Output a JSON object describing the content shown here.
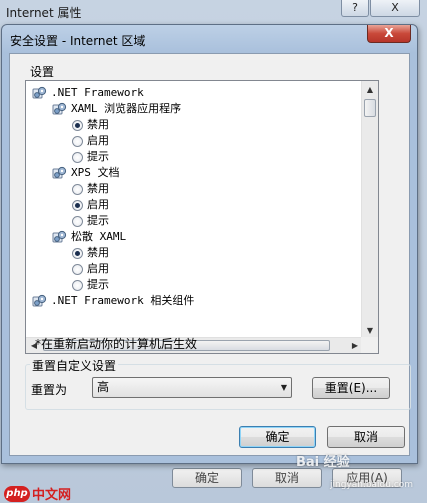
{
  "background_window": {
    "title": "Internet 属性",
    "help_label": "?",
    "close_label": "X",
    "ok_label": "确定",
    "cancel_label": "取消",
    "apply_label": "应用(A)"
  },
  "dialog": {
    "title": "安全设置 - Internet 区域",
    "close_label": "X",
    "settings_label": "设置",
    "tree": [
      {
        "kind": "gear",
        "indent": 0,
        "label": ".NET Framework",
        "mono": true
      },
      {
        "kind": "gear",
        "indent": 1,
        "label": "XAML 浏览器应用程序",
        "mono": true
      },
      {
        "kind": "radio",
        "indent": 2,
        "label": "禁用",
        "checked": true
      },
      {
        "kind": "radio",
        "indent": 2,
        "label": "启用",
        "checked": false
      },
      {
        "kind": "radio",
        "indent": 2,
        "label": "提示",
        "checked": false
      },
      {
        "kind": "gear",
        "indent": 1,
        "label": "XPS 文档",
        "mono": true
      },
      {
        "kind": "radio",
        "indent": 2,
        "label": "禁用",
        "checked": false
      },
      {
        "kind": "radio",
        "indent": 2,
        "label": "启用",
        "checked": true
      },
      {
        "kind": "radio",
        "indent": 2,
        "label": "提示",
        "checked": false
      },
      {
        "kind": "gear",
        "indent": 1,
        "label": "松散 XAML",
        "mono": true
      },
      {
        "kind": "radio",
        "indent": 2,
        "label": "禁用",
        "checked": true
      },
      {
        "kind": "radio",
        "indent": 2,
        "label": "启用",
        "checked": false
      },
      {
        "kind": "radio",
        "indent": 2,
        "label": "提示",
        "checked": false
      },
      {
        "kind": "gear",
        "indent": 0,
        "label": ".NET Framework 相关组件",
        "mono": true
      }
    ],
    "restart_note": "*在重新启动你的计算机后生效",
    "reset_group_label": "重置自定义设置",
    "reset_to_label": "重置为",
    "reset_level": "高",
    "reset_button": "重置(E)...",
    "ok_button": "确定",
    "cancel_button": "取消"
  },
  "watermarks": {
    "php_logo": "php",
    "php_text": "中文网",
    "baidu_text": "Bai 经验",
    "baidu_sub": "jingyan.baidu.com"
  }
}
